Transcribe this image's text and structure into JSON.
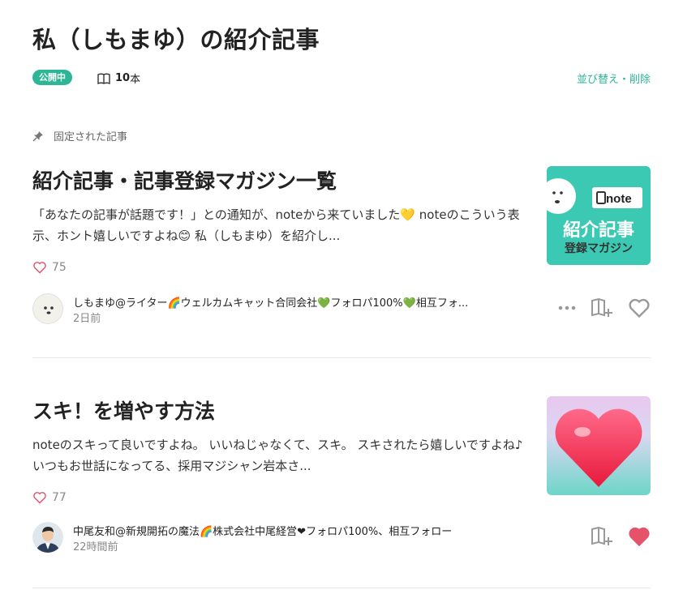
{
  "header": {
    "title": "私（しもまゆ）の紹介記事",
    "status_badge": "公開中",
    "count_number": "10",
    "count_unit": "本",
    "sort_delete_link": "並び替え・削除"
  },
  "pinned_label": "固定された記事",
  "articles": [
    {
      "title": "紹介記事・記事登録マガジン一覧",
      "excerpt": "「あなたの記事が話題です！」との通知が、noteから来ていました💛 noteのこういう表示、ホント嬉しいですよね😊 私（しもまゆ）を紹介し...",
      "likes": "75",
      "author": "しもまゆ@ライター🌈ウェルカムキャット合同会社💚フォロパ100%💚相互フォ...",
      "time": "2日前",
      "liked": false,
      "thumb_text_logo": "note",
      "thumb_text_main": "紹介記事",
      "thumb_text_sub": "登録マガジン"
    },
    {
      "title": "スキ！を増やす方法",
      "excerpt": "noteのスキって良いですよね。 いいねじゃなくて、スキ。 スキされたら嬉しいですよね♪ いつもお世話になってる、採用マジシャン岩本さ...",
      "likes": "77",
      "author": "中尾友和@新規開拓の魔法🌈株式会社中尾経営❤フォロパ100%、相互フォロー",
      "time": "22時間前",
      "liked": true
    }
  ],
  "colors": {
    "accent": "#2cb696",
    "like_red": "#e5536b",
    "thumb1_bg": "#3cc9b3"
  },
  "icons": [
    "book-icon",
    "pin-icon",
    "heart-icon",
    "more-icon",
    "magazine-add-icon",
    "like-icon"
  ]
}
